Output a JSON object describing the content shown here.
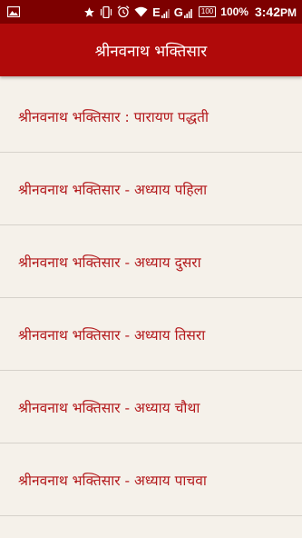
{
  "status_bar": {
    "network_letter_1": "E",
    "network_letter_2": "G",
    "battery_box": "100",
    "battery_percent": "100%",
    "time": "3:42",
    "time_suffix": "PM"
  },
  "app_bar": {
    "title": "श्रीनवनाथ भक्तिसार"
  },
  "list": {
    "items": [
      {
        "label": "श्रीनवनाथ भक्तिसार : पारायण पद्धती"
      },
      {
        "label": "श्रीनवनाथ भक्तिसार - अध्याय पहिला"
      },
      {
        "label": "श्रीनवनाथ भक्तिसार - अध्याय दुसरा"
      },
      {
        "label": "श्रीनवनाथ भक्तिसार - अध्याय तिसरा"
      },
      {
        "label": "श्रीनवनाथ भक्तिसार - अध्याय चौथा"
      },
      {
        "label": "श्रीनवनाथ भक्तिसार - अध्याय पाचवा"
      }
    ]
  },
  "colors": {
    "status_bar": "#7d0000",
    "app_bar": "#b00a0a",
    "background": "#f5f1ea",
    "item_text": "#b3191c",
    "divider": "#d6d2cb"
  },
  "icons": [
    "image-notification-icon",
    "star-icon",
    "vibrate-icon",
    "alarm-icon",
    "wifi-icon",
    "signal-icon",
    "battery-icon"
  ]
}
